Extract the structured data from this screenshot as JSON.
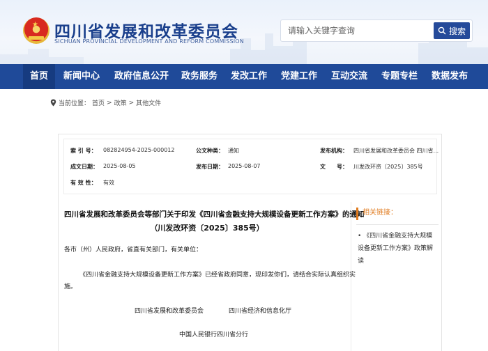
{
  "header": {
    "title": "四川省发展和改革委员会",
    "subtitle": "SICHUAN PROVINCIAL DEVELOPMENT AND REFORM COMMISSION",
    "search_placeholder": "请输入关键字查询",
    "search_button": "搜索"
  },
  "nav": {
    "items": [
      {
        "label": "首页"
      },
      {
        "label": "新闻中心"
      },
      {
        "label": "政府信息公开"
      },
      {
        "label": "政务服务"
      },
      {
        "label": "发改工作"
      },
      {
        "label": "党建工作"
      },
      {
        "label": "互动交流"
      },
      {
        "label": "专题专栏"
      },
      {
        "label": "数据发布"
      }
    ]
  },
  "breadcrumb": {
    "prefix": "当前位置：",
    "items": [
      "首页",
      "政策",
      "其他文件"
    ],
    "sep": ">"
  },
  "info": {
    "index_label": "索 引 号：",
    "index_value": "082824954-2025-000012",
    "type_label": "公文种类：",
    "type_value": "通知",
    "org_label": "发布机构：",
    "org_value": "四川省发展和改革委员会 四川省...",
    "made_label": "成文日期：",
    "made_value": "2025-08-05",
    "pub_label": "发布日期：",
    "pub_value": "2025-08-07",
    "num_label": "文　　号：",
    "num_value": "川发改环资〔2025〕385号",
    "valid_label": "有 效 性：",
    "valid_value": "有效"
  },
  "document": {
    "title_line1": "四川省发展和改革委员会等部门关于印发《四川省金融支持大规模设备更新工作方案》的通知",
    "title_line2": "（川发改环资〔2025〕385号）",
    "salutation": "各市（州）人民政府，省直有关部门，有关单位：",
    "body_line1": "《四川省金融支持大规模设备更新工作方案》已经省政府同意，现印发你们，请结合实际认真组织实",
    "body_line2": "施。",
    "signer1": "四川省发展和改革委员会",
    "signer2": "四川省经济和信息化厅",
    "signer3": "中国人民银行四川省分行"
  },
  "sidebar": {
    "heading": "相关链接：",
    "link": "《四川省金融支持大规模设备更新工作方案》政策解读"
  },
  "colors": {
    "nav_bg": "#1f4a99",
    "nav_active": "#163b80",
    "title": "#1a3f8c",
    "accent": "#e07b1f"
  }
}
